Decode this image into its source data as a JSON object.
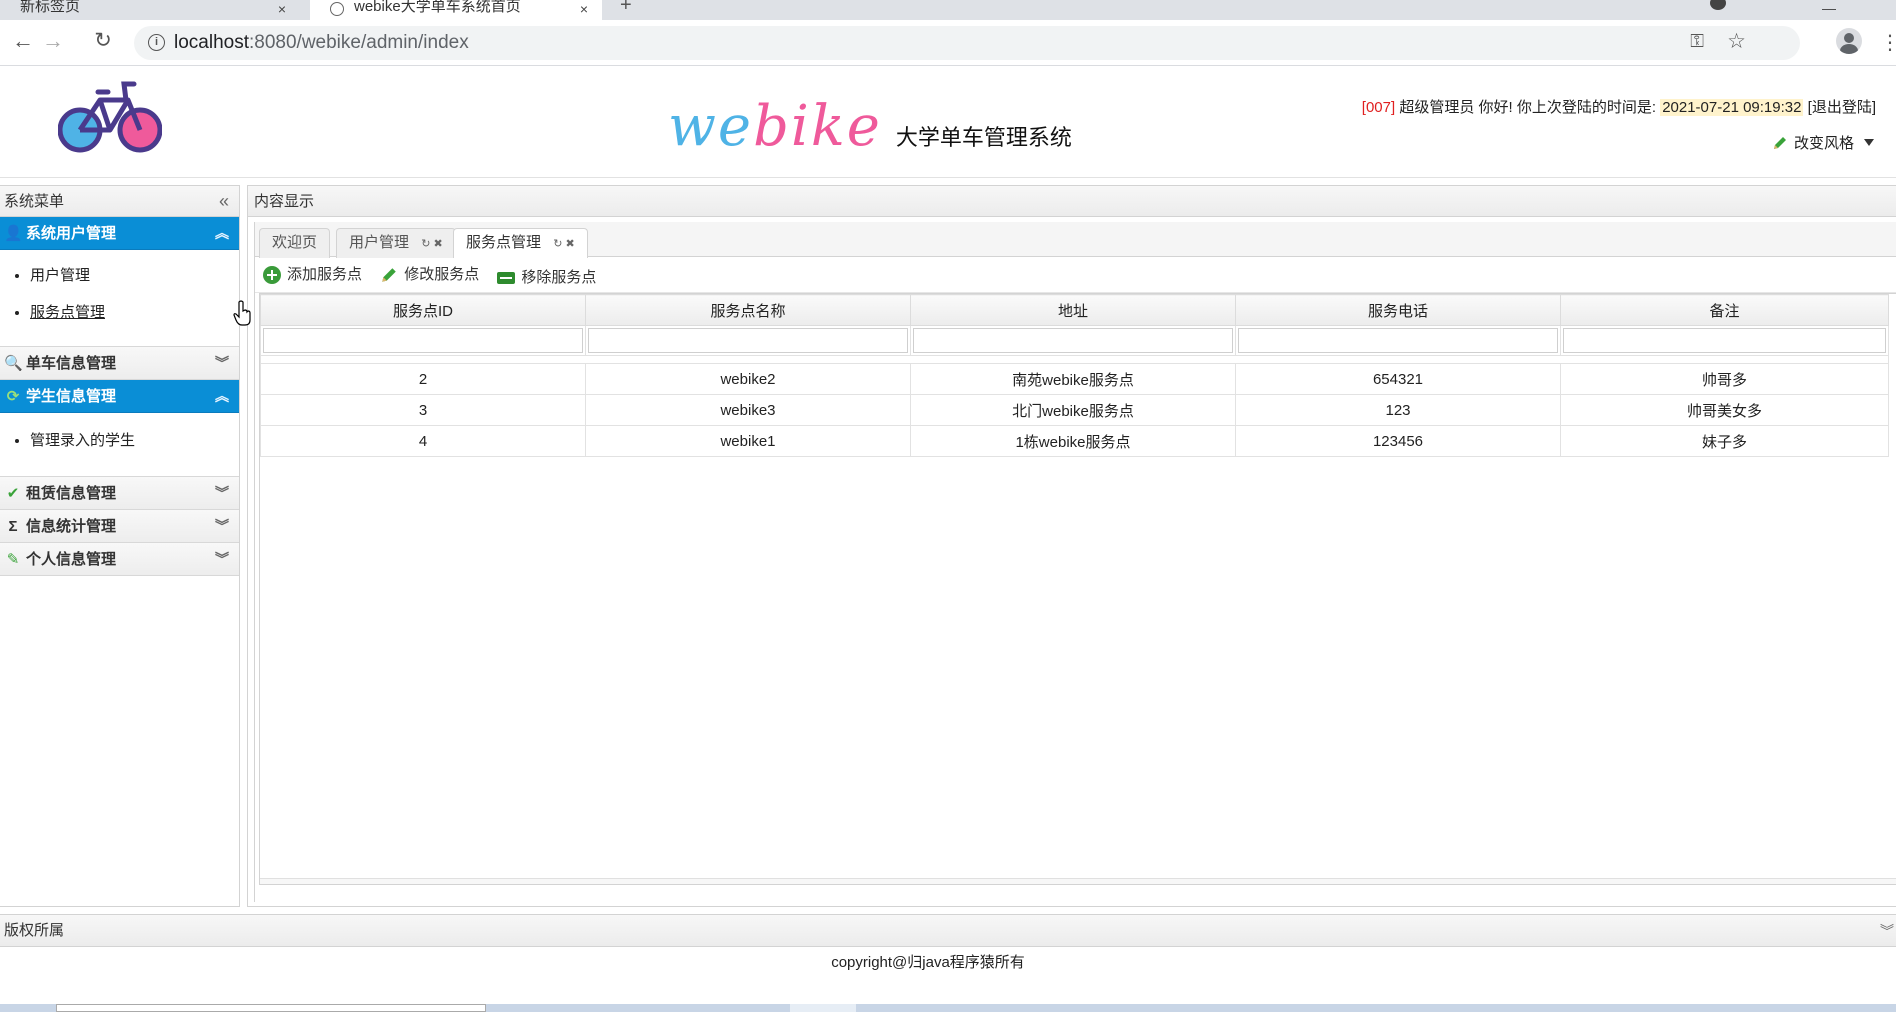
{
  "browser": {
    "tabs": [
      {
        "label": "新标签页"
      },
      {
        "label": "webike大学单车系统首页"
      }
    ],
    "new_tab": "+",
    "close": "×",
    "url_host": "localhost",
    "url_path": ":8080/webike/admin/index"
  },
  "header": {
    "brand_we": "we",
    "brand_bike": "bike",
    "brand_system": "大学单车管理系统",
    "user_code": "[007]",
    "user_greeting": "超级管理员 你好! 你上次登陆的时间是:",
    "last_login": "2021-07-21 09:19:32",
    "logout": "[退出登陆]",
    "change_style": "改变风格",
    "colors": {
      "we": "#4fb3e6",
      "bike": "#ef5a9b",
      "wheel_left": "#4fb3e6",
      "wheel_right": "#ef5a9b",
      "frame": "#4a3a8c"
    }
  },
  "sidebar": {
    "title": "系统菜单",
    "sections": [
      {
        "label": "系统用户管理",
        "icon": "user-icon",
        "open": true,
        "items": [
          "用户管理",
          "服务点管理"
        ]
      },
      {
        "label": "单车信息管理",
        "icon": "search-icon",
        "open": false,
        "items": []
      },
      {
        "label": "学生信息管理",
        "icon": "refresh-icon",
        "open": true,
        "items": [
          "管理录入的学生"
        ]
      },
      {
        "label": "租赁信息管理",
        "icon": "check-icon",
        "open": false,
        "items": []
      },
      {
        "label": "信息统计管理",
        "icon": "sigma-icon",
        "open": false,
        "items": []
      },
      {
        "label": "个人信息管理",
        "icon": "pencil-icon",
        "open": false,
        "items": []
      }
    ],
    "accent": "#0a8ed6"
  },
  "main": {
    "title": "内容显示",
    "tabs": [
      {
        "label": "欢迎页",
        "active": false,
        "closable": false
      },
      {
        "label": "用户管理",
        "active": false,
        "closable": true
      },
      {
        "label": "服务点管理",
        "active": true,
        "closable": true
      }
    ],
    "toolbar": {
      "add": "添加服务点",
      "edit": "修改服务点",
      "remove": "移除服务点"
    },
    "table": {
      "columns": [
        "服务点ID",
        "服务点名称",
        "地址",
        "服务电话",
        "备注"
      ],
      "rows": [
        [
          "2",
          "webike2",
          "南苑webike服务点",
          "654321",
          "帅哥多"
        ],
        [
          "3",
          "webike3",
          "北门webike服务点",
          "123",
          "帅哥美女多"
        ],
        [
          "4",
          "webike1",
          "1栋webike服务点",
          "123456",
          "妹子多"
        ]
      ]
    }
  },
  "footer": {
    "title": "版权所属",
    "copyright": "copyright@归java程序猿所有"
  }
}
